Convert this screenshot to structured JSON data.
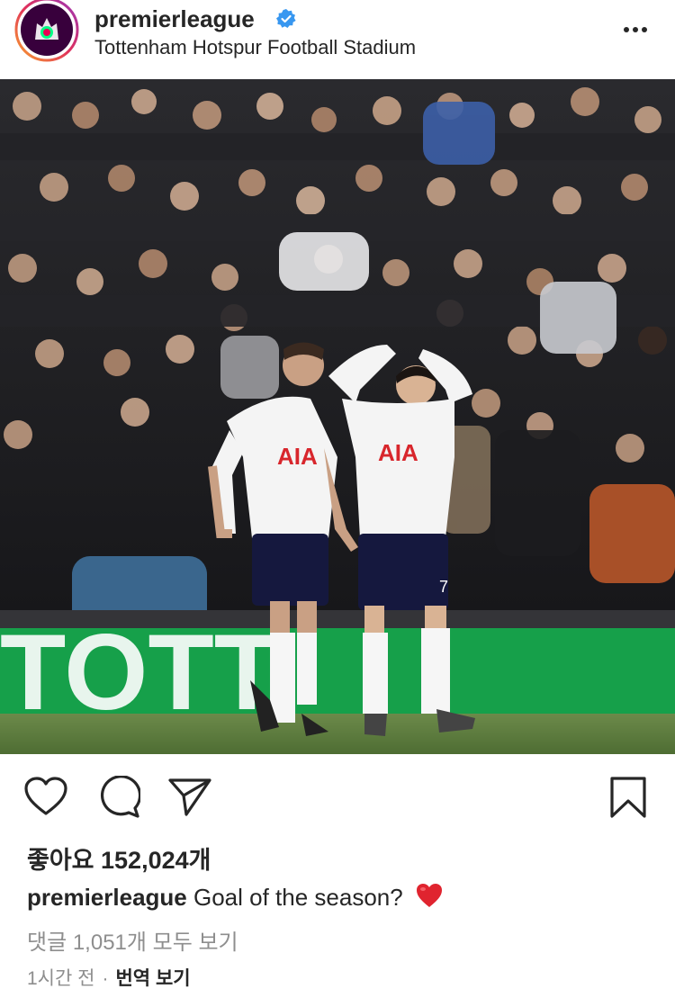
{
  "post": {
    "username": "premierleague",
    "location": "Tottenham Hotspur Football Stadium",
    "likes_text": "좋아요 152,024개",
    "caption_user": "premierleague",
    "caption_text": "Goal of the season?",
    "caption_emoji": "red-heart",
    "comments_text": "댓글 1,051개 모두 보기",
    "time": "1시간 전",
    "separator": "·",
    "translate": "번역 보기"
  },
  "photo": {
    "shirt_text_left": "AIA",
    "shirt_text_right": "AIA",
    "shirt_number": "7",
    "banner_text": "TOTT"
  },
  "icons": {
    "avatar": "premier-league-lion-logo",
    "verified": "verified-badge-icon",
    "more": "more-options-icon",
    "like": "heart-icon",
    "comment": "comment-icon",
    "share": "paper-plane-icon",
    "save": "bookmark-icon"
  },
  "colors": {
    "accent_verified": "#3897f0",
    "heart_red": "#e0242f",
    "text": "#262626",
    "muted": "#8e8e8e",
    "pl_purple": "#38003c"
  }
}
